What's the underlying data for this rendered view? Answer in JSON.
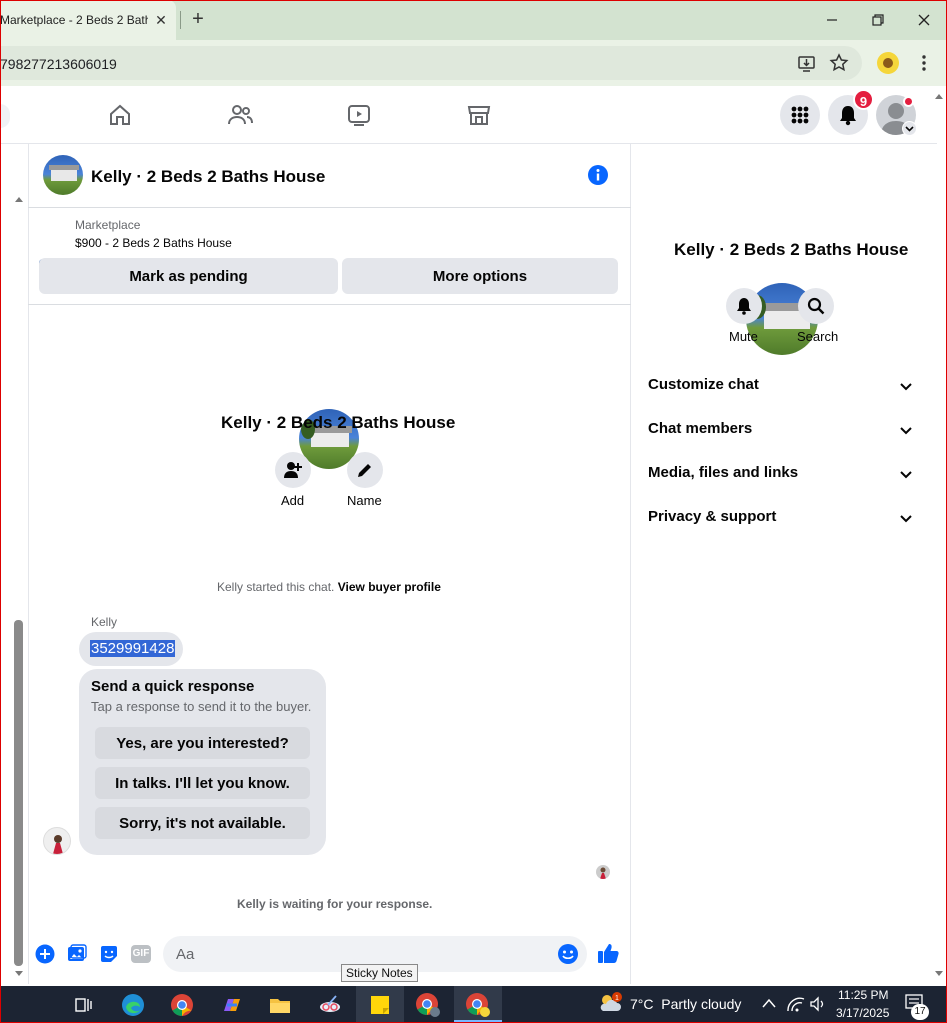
{
  "browser": {
    "tab_title": "Marketplace - 2 Beds 2 Bath",
    "url": "798277213606019"
  },
  "nav": {
    "notifications_count": "9"
  },
  "conversation": {
    "title": "Kelly · 2 Beds 2 Baths House",
    "listing_source": "Marketplace",
    "listing_summary": "$900 - 2 Beds 2 Baths House",
    "mark_pending_label": "Mark as pending",
    "more_options_label": "More options",
    "intro_title": "Kelly · 2 Beds 2 Baths House",
    "add_label": "Add",
    "name_label": "Name",
    "started_text": "Kelly started this chat.",
    "view_profile_link": "View buyer profile",
    "sender_name": "Kelly",
    "phone_message": "3529991428",
    "quick_title": "Send a quick response",
    "quick_subtitle": "Tap a response to send it to the buyer.",
    "quick_responses": [
      "Yes, are you interested?",
      "In talks. I'll let you know.",
      "Sorry, it's not available."
    ],
    "waiting_text": "Kelly is waiting for your response.",
    "composer_placeholder": "Aa"
  },
  "right_panel": {
    "title": "Kelly · 2 Beds 2 Baths House",
    "mute_label": "Mute",
    "search_label": "Search",
    "sections": [
      "Customize chat",
      "Chat members",
      "Media, files and links",
      "Privacy & support"
    ]
  },
  "taskbar": {
    "tooltip": "Sticky Notes",
    "weather": "7°C  Partly cloudy",
    "time": "11:25 PM",
    "date": "3/17/2025",
    "notification_count": "17"
  },
  "colors": {
    "fb_blue": "#0866ff",
    "badge_red": "#e41e3f",
    "selection": "#3367d6"
  }
}
